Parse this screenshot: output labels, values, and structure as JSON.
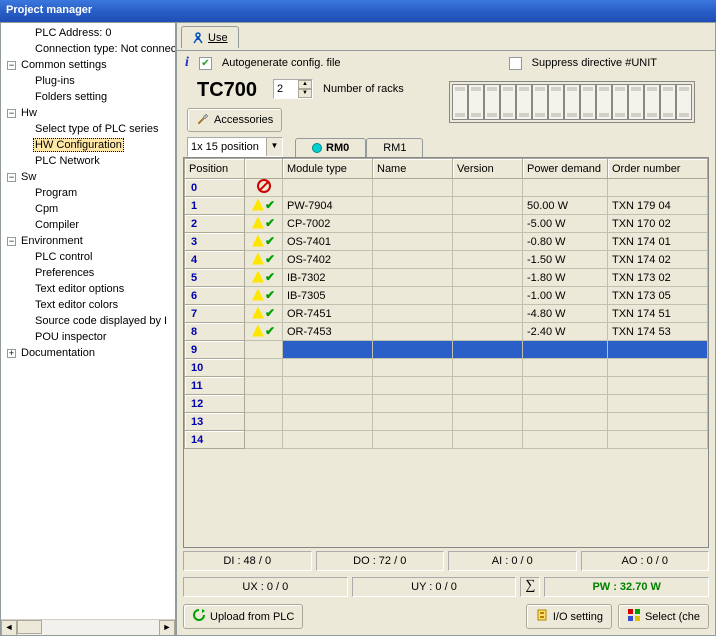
{
  "title": "Project manager",
  "tree": {
    "items0": [
      {
        "label": "PLC Address: 0"
      },
      {
        "label": "Connection type: Not connecte"
      }
    ],
    "nodes": [
      {
        "label": "Common settings",
        "items": [
          "Plug-ins",
          "Folders setting"
        ]
      },
      {
        "label": "Hw",
        "items": [
          "Select type of PLC series",
          "HW Configuration",
          "PLC Network"
        ],
        "sel": 1
      },
      {
        "label": "Sw",
        "items": [
          "Program",
          "Cpm",
          "Compiler"
        ]
      },
      {
        "label": "Environment",
        "items": [
          "PLC control",
          "Preferences",
          "Text editor options",
          "Text editor colors",
          "Source code displayed by I",
          "POU inspector"
        ]
      }
    ],
    "closed": {
      "label": "Documentation"
    }
  },
  "tabs": {
    "use": "Use"
  },
  "toprow": {
    "autogen_label": "Autogenerate config. file",
    "suppress_label": "Suppress directive #UNIT",
    "autogen_checked": "✔",
    "suppress_checked": ""
  },
  "model": "TC700",
  "racks_value": "2",
  "racks_label": "Number of racks",
  "accessories_btn": "Accessories",
  "combo_value": "1x 15 position",
  "rmtabs": {
    "rm0": "RM0",
    "rm1": "RM1"
  },
  "grid": {
    "headers": [
      "Position",
      "",
      "Module type",
      "Name",
      "Version",
      "Power demand",
      "Order number"
    ],
    "rows": [
      {
        "pos": "0",
        "status": "no"
      },
      {
        "pos": "1",
        "status": "wc",
        "mtype": "PW-7904",
        "power": "50.00 W",
        "order": "TXN 179 04"
      },
      {
        "pos": "2",
        "status": "wc",
        "mtype": "CP-7002",
        "power": "-5.00 W",
        "order": "TXN 170 02"
      },
      {
        "pos": "3",
        "status": "wc",
        "mtype": "OS-7401",
        "power": "-0.80 W",
        "order": "TXN 174 01"
      },
      {
        "pos": "4",
        "status": "wc",
        "mtype": "OS-7402",
        "power": "-1.50 W",
        "order": "TXN 174 02"
      },
      {
        "pos": "5",
        "status": "wc",
        "mtype": "IB-7302",
        "power": "-1.80 W",
        "order": "TXN 173 02"
      },
      {
        "pos": "6",
        "status": "wc",
        "mtype": "IB-7305",
        "power": "-1.00 W",
        "order": "TXN 173 05"
      },
      {
        "pos": "7",
        "status": "wc",
        "mtype": "OR-7451",
        "power": "-4.80 W",
        "order": "TXN 174 51"
      },
      {
        "pos": "8",
        "status": "wc",
        "mtype": "OR-7453",
        "power": "-2.40 W",
        "order": "TXN 174 53"
      },
      {
        "pos": "9",
        "sel": true
      },
      {
        "pos": "10"
      },
      {
        "pos": "11"
      },
      {
        "pos": "12"
      },
      {
        "pos": "13"
      },
      {
        "pos": "14"
      }
    ]
  },
  "status": {
    "di": "DI : 48 / 0",
    "do": "DO : 72 / 0",
    "ai": "AI : 0 / 0",
    "ao": "AO : 0 / 0",
    "ux": "UX : 0 / 0",
    "uy": "UY : 0 / 0",
    "pw": "PW :  32.70 W"
  },
  "buttons": {
    "upload": "Upload from PLC",
    "io": "I/O setting",
    "select": "Select (che"
  }
}
